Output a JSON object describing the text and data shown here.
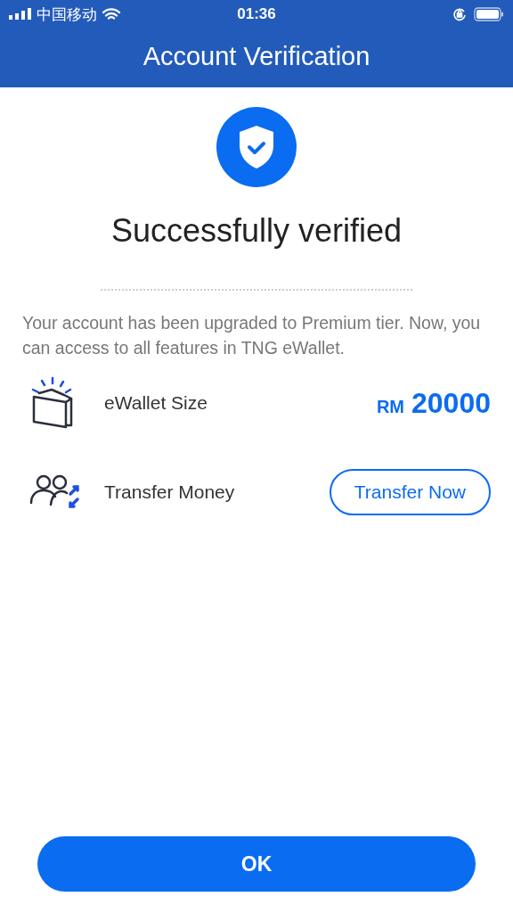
{
  "status_bar": {
    "carrier": "中国移动",
    "time": "01:36"
  },
  "header": {
    "title": "Account Verification"
  },
  "result": {
    "title": "Successfully verified",
    "message": "Your account has been upgraded to Premium tier. Now, you can access to all features in TNG eWallet."
  },
  "features": [
    {
      "kind": "amount",
      "label": "eWallet Size",
      "currency": "RM",
      "amount": "20000"
    },
    {
      "kind": "action",
      "label": "Transfer Money",
      "button": "Transfer Now"
    }
  ],
  "buttons": [
    "OK"
  ]
}
